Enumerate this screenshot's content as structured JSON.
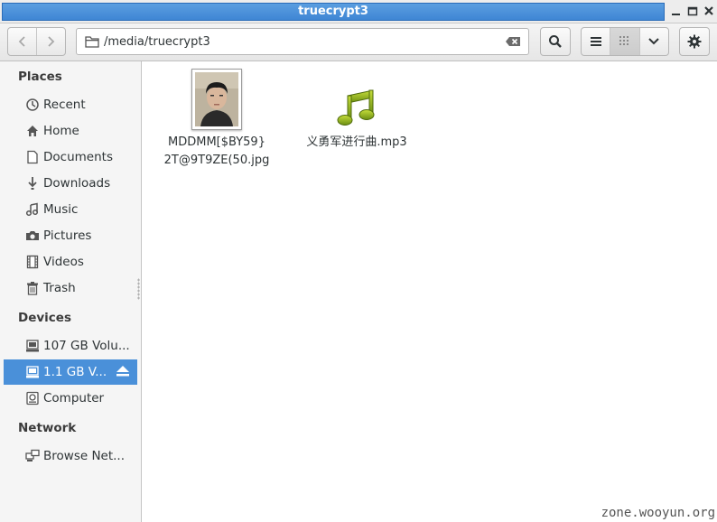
{
  "window": {
    "title": "truecrypt3"
  },
  "header": {
    "path": "/media/truecrypt3"
  },
  "sidebar": {
    "places_heading": "Places",
    "places": [
      {
        "label": "Recent",
        "icon": "clock-icon"
      },
      {
        "label": "Home",
        "icon": "home-icon"
      },
      {
        "label": "Documents",
        "icon": "document-icon"
      },
      {
        "label": "Downloads",
        "icon": "download-icon"
      },
      {
        "label": "Music",
        "icon": "music-icon"
      },
      {
        "label": "Pictures",
        "icon": "camera-icon"
      },
      {
        "label": "Videos",
        "icon": "film-icon"
      },
      {
        "label": "Trash",
        "icon": "trash-icon"
      }
    ],
    "devices_heading": "Devices",
    "devices": [
      {
        "label": "107 GB Volu...",
        "icon": "drive-icon"
      },
      {
        "label": "1.1 GB V...",
        "icon": "drive-icon",
        "selected": true
      },
      {
        "label": "Computer",
        "icon": "computer-icon"
      }
    ],
    "network_heading": "Network",
    "network": [
      {
        "label": "Browse Net...",
        "icon": "network-icon"
      }
    ]
  },
  "files": [
    {
      "name_line1": "MDDMM[$BY59}",
      "name_line2": "2T@9T9ZE(50.jpg",
      "type": "image"
    },
    {
      "name_line1": "义勇军进行曲.mp3",
      "type": "audio"
    }
  ],
  "watermark": "zone.wooyun.org",
  "colors": {
    "accent": "#4a90d9",
    "titlebar": "#3f86d4"
  }
}
